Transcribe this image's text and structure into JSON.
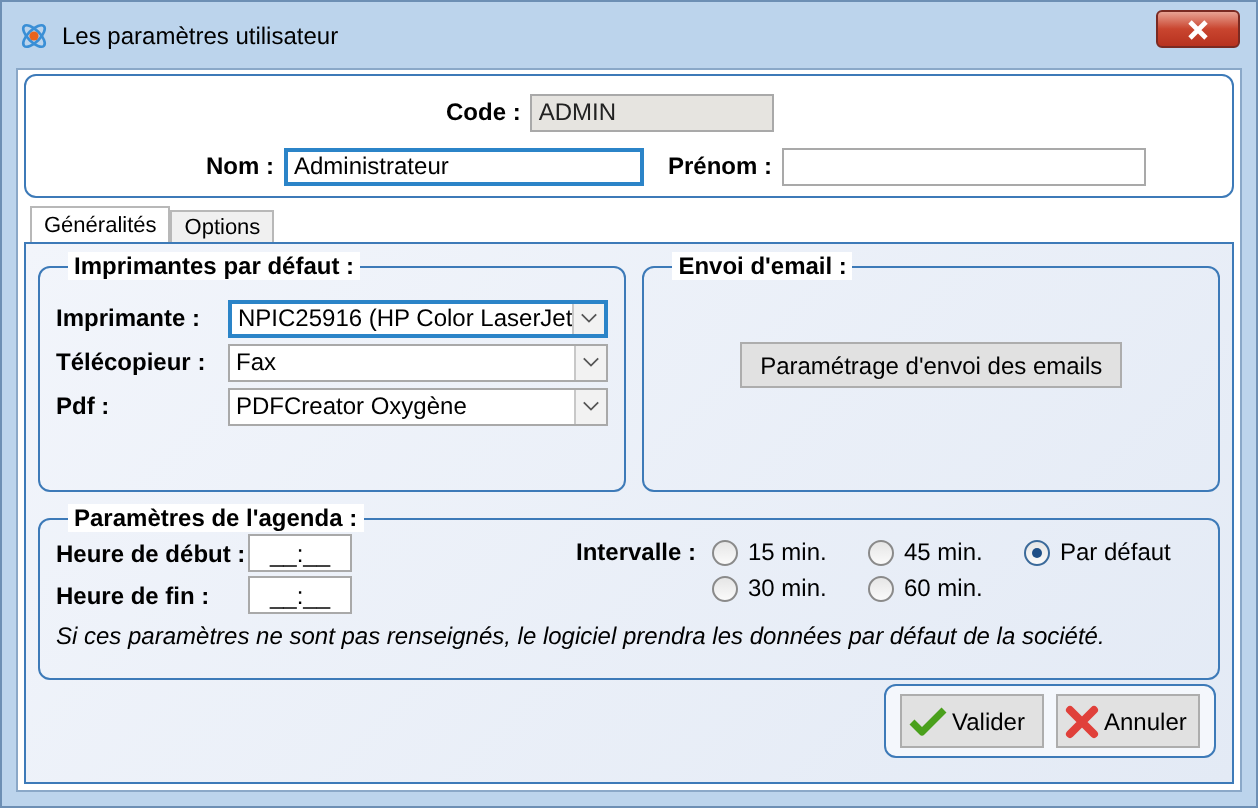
{
  "window": {
    "title": "Les paramètres utilisateur"
  },
  "header": {
    "code": {
      "label": "Code :",
      "value": "ADMIN",
      "disabled": true
    },
    "nom": {
      "label": "Nom :",
      "value": "Administrateur"
    },
    "prenom": {
      "label": "Prénom :"
    }
  },
  "tabs": [
    {
      "label": "Généralités",
      "selected": true
    },
    {
      "label": "Options",
      "selected": false
    }
  ],
  "printers": {
    "title": "Imprimantes par défaut :",
    "rows": [
      {
        "label": "Imprimante :",
        "value": "NPIC25916 (HP Color LaserJet",
        "focused": true
      },
      {
        "label": "Télécopieur :",
        "value": "Fax",
        "focused": false
      },
      {
        "label": "Pdf :",
        "value": "PDFCreator Oxygène",
        "focused": false
      }
    ]
  },
  "email": {
    "title": "Envoi d'email :",
    "button": "Paramétrage d'envoi des emails"
  },
  "agenda": {
    "title": "Paramètres de l'agenda :",
    "start": {
      "label": "Heure de début :",
      "value": "__:__"
    },
    "end": {
      "label": "Heure de fin :",
      "value": "__:__"
    },
    "interval_label": "Intervalle :",
    "options": [
      {
        "label": "15 min.",
        "selected": false
      },
      {
        "label": "45 min.",
        "selected": false
      },
      {
        "label": "Par défaut",
        "selected": true
      },
      {
        "label": "30 min.",
        "selected": false
      },
      {
        "label": "60 min.",
        "selected": false
      }
    ],
    "note": "Si ces paramètres ne sont pas renseignés, le logiciel prendra les données par défaut de la société."
  },
  "buttons": [
    {
      "kind": "ok",
      "label": "Valider"
    },
    {
      "kind": "cancel",
      "label": "Annuler"
    }
  ]
}
